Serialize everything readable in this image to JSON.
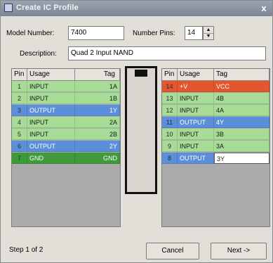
{
  "window": {
    "title": "Create IC Profile",
    "close": "x"
  },
  "form": {
    "model_label": "Model Number:",
    "model_value": "7400",
    "pins_label": "Number Pins:",
    "pins_value": "14",
    "description_label": "Description:",
    "description_value": "Quad 2 Input NAND"
  },
  "left_table": {
    "headers": {
      "pin": "Pin",
      "usage": "Usage",
      "tag": "Tag"
    },
    "rows": [
      {
        "pin": "1",
        "usage": "INPUT",
        "tag": "1A",
        "color": "#a6dc96"
      },
      {
        "pin": "2",
        "usage": "INPUT",
        "tag": "1B",
        "color": "#a6dc96"
      },
      {
        "pin": "3",
        "usage": "OUTPUT",
        "tag": "1Y",
        "color": "#5b8fd9"
      },
      {
        "pin": "4",
        "usage": "INPUT",
        "tag": "2A",
        "color": "#a6dc96"
      },
      {
        "pin": "5",
        "usage": "INPUT",
        "tag": "2B",
        "color": "#a6dc96"
      },
      {
        "pin": "6",
        "usage": "OUTPUT",
        "tag": "2Y",
        "color": "#5b8fd9"
      },
      {
        "pin": "7",
        "usage": "GND",
        "tag": "GND",
        "color": "#3f9a3a"
      }
    ]
  },
  "right_table": {
    "headers": {
      "pin": "Pin",
      "usage": "Usage",
      "tag": "Tag"
    },
    "rows": [
      {
        "pin": "14",
        "usage": "+V",
        "tag": "VCC",
        "color": "#e4572e"
      },
      {
        "pin": "13",
        "usage": "INPUT",
        "tag": "4B",
        "color": "#a6dc96"
      },
      {
        "pin": "12",
        "usage": "INPUT",
        "tag": "4A",
        "color": "#a6dc96"
      },
      {
        "pin": "11",
        "usage": "OUTPUT",
        "tag": "4Y",
        "color": "#5b8fd9"
      },
      {
        "pin": "10",
        "usage": "INPUT",
        "tag": "3B",
        "color": "#a6dc96"
      },
      {
        "pin": "9",
        "usage": "INPUT",
        "tag": "3A",
        "color": "#a6dc96"
      },
      {
        "pin": "8",
        "usage": "OUTPUT",
        "tag": "3Y",
        "color": "#5b8fd9"
      }
    ]
  },
  "footer": {
    "step": "Step 1 of 2",
    "cancel": "Cancel",
    "next": "Next ->"
  }
}
